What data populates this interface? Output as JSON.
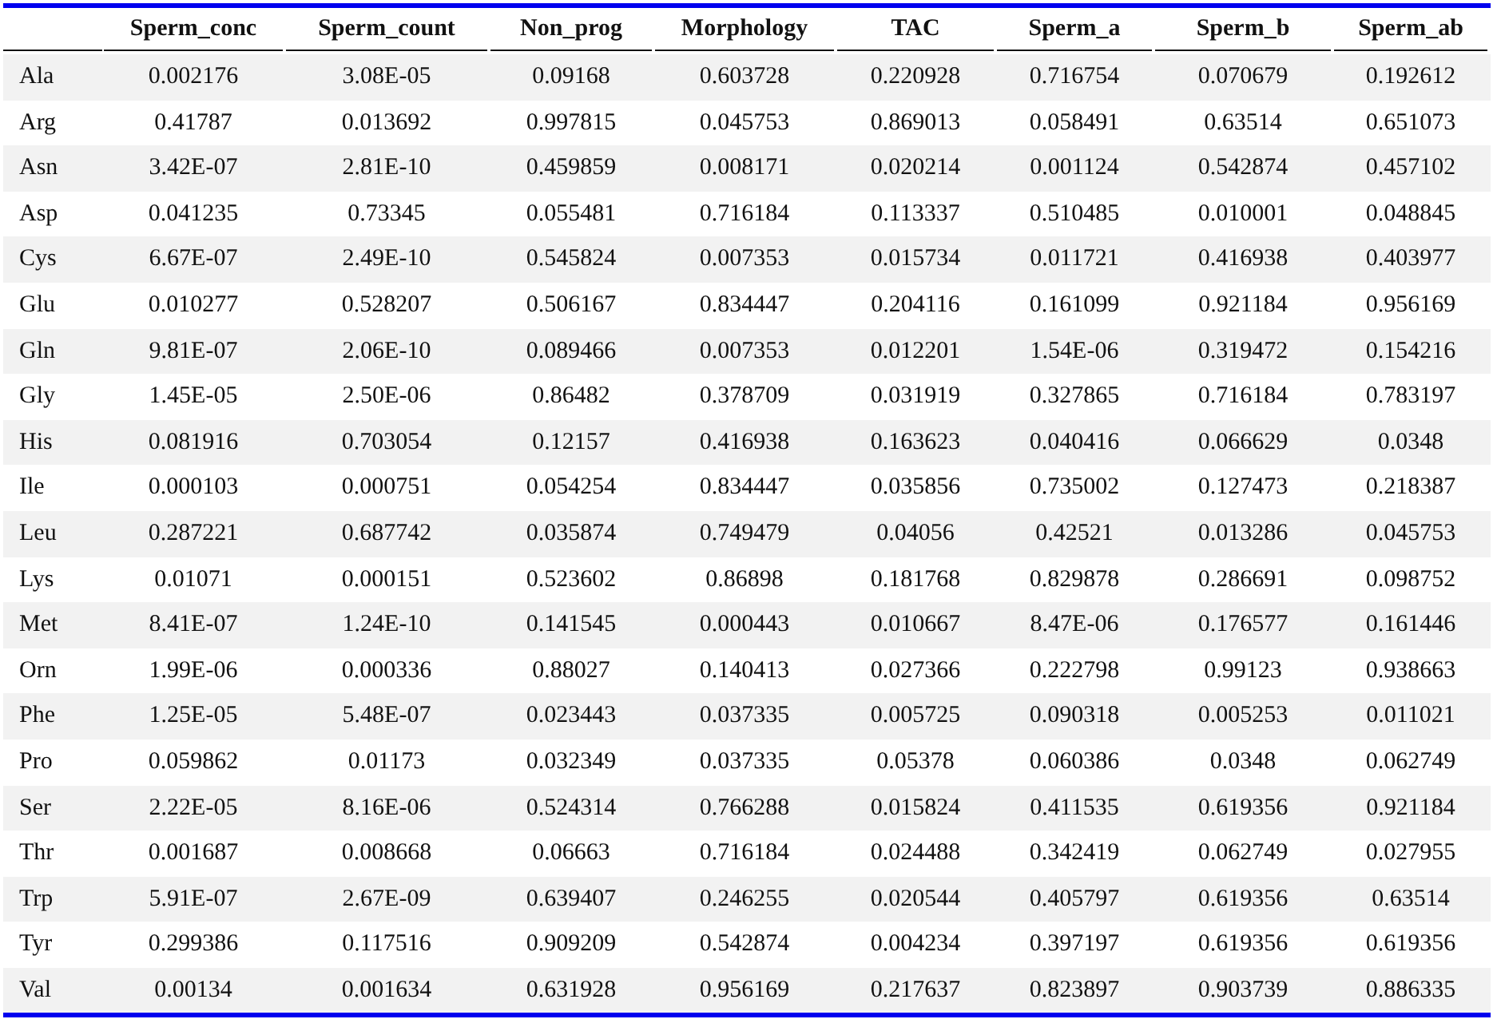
{
  "table": {
    "columns": [
      "Sperm_conc",
      "Sperm_count",
      "Non_prog",
      "Morphology",
      "TAC",
      "Sperm_a",
      "Sperm_b",
      "Sperm_ab"
    ],
    "rows": [
      {
        "label": "Ala",
        "values": [
          "0.002176",
          "3.08E-05",
          "0.09168",
          "0.603728",
          "0.220928",
          "0.716754",
          "0.070679",
          "0.192612"
        ]
      },
      {
        "label": "Arg",
        "values": [
          "0.41787",
          "0.013692",
          "0.997815",
          "0.045753",
          "0.869013",
          "0.058491",
          "0.63514",
          "0.651073"
        ]
      },
      {
        "label": "Asn",
        "values": [
          "3.42E-07",
          "2.81E-10",
          "0.459859",
          "0.008171",
          "0.020214",
          "0.001124",
          "0.542874",
          "0.457102"
        ]
      },
      {
        "label": "Asp",
        "values": [
          "0.041235",
          "0.73345",
          "0.055481",
          "0.716184",
          "0.113337",
          "0.510485",
          "0.010001",
          "0.048845"
        ]
      },
      {
        "label": "Cys",
        "values": [
          "6.67E-07",
          "2.49E-10",
          "0.545824",
          "0.007353",
          "0.015734",
          "0.011721",
          "0.416938",
          "0.403977"
        ]
      },
      {
        "label": "Glu",
        "values": [
          "0.010277",
          "0.528207",
          "0.506167",
          "0.834447",
          "0.204116",
          "0.161099",
          "0.921184",
          "0.956169"
        ]
      },
      {
        "label": "Gln",
        "values": [
          "9.81E-07",
          "2.06E-10",
          "0.089466",
          "0.007353",
          "0.012201",
          "1.54E-06",
          "0.319472",
          "0.154216"
        ]
      },
      {
        "label": "Gly",
        "values": [
          "1.45E-05",
          "2.50E-06",
          "0.86482",
          "0.378709",
          "0.031919",
          "0.327865",
          "0.716184",
          "0.783197"
        ]
      },
      {
        "label": "His",
        "values": [
          "0.081916",
          "0.703054",
          "0.12157",
          "0.416938",
          "0.163623",
          "0.040416",
          "0.066629",
          "0.0348"
        ]
      },
      {
        "label": "Ile",
        "values": [
          "0.000103",
          "0.000751",
          "0.054254",
          "0.834447",
          "0.035856",
          "0.735002",
          "0.127473",
          "0.218387"
        ]
      },
      {
        "label": "Leu",
        "values": [
          "0.287221",
          "0.687742",
          "0.035874",
          "0.749479",
          "0.04056",
          "0.42521",
          "0.013286",
          "0.045753"
        ]
      },
      {
        "label": "Lys",
        "values": [
          "0.01071",
          "0.000151",
          "0.523602",
          "0.86898",
          "0.181768",
          "0.829878",
          "0.286691",
          "0.098752"
        ]
      },
      {
        "label": "Met",
        "values": [
          "8.41E-07",
          "1.24E-10",
          "0.141545",
          "0.000443",
          "0.010667",
          "8.47E-06",
          "0.176577",
          "0.161446"
        ]
      },
      {
        "label": "Orn",
        "values": [
          "1.99E-06",
          "0.000336",
          "0.88027",
          "0.140413",
          "0.027366",
          "0.222798",
          "0.99123",
          "0.938663"
        ]
      },
      {
        "label": "Phe",
        "values": [
          "1.25E-05",
          "5.48E-07",
          "0.023443",
          "0.037335",
          "0.005725",
          "0.090318",
          "0.005253",
          "0.011021"
        ]
      },
      {
        "label": "Pro",
        "values": [
          "0.059862",
          "0.01173",
          "0.032349",
          "0.037335",
          "0.05378",
          "0.060386",
          "0.0348",
          "0.062749"
        ]
      },
      {
        "label": "Ser",
        "values": [
          "2.22E-05",
          "8.16E-06",
          "0.524314",
          "0.766288",
          "0.015824",
          "0.411535",
          "0.619356",
          "0.921184"
        ]
      },
      {
        "label": "Thr",
        "values": [
          "0.001687",
          "0.008668",
          "0.06663",
          "0.716184",
          "0.024488",
          "0.342419",
          "0.062749",
          "0.027955"
        ]
      },
      {
        "label": "Trp",
        "values": [
          "5.91E-07",
          "2.67E-09",
          "0.639407",
          "0.246255",
          "0.020544",
          "0.405797",
          "0.619356",
          "0.63514"
        ]
      },
      {
        "label": "Tyr",
        "values": [
          "0.299386",
          "0.117516",
          "0.909209",
          "0.542874",
          "0.004234",
          "0.397197",
          "0.619356",
          "0.619356"
        ]
      },
      {
        "label": "Val",
        "values": [
          "0.00134",
          "0.001634",
          "0.631928",
          "0.956169",
          "0.217637",
          "0.823897",
          "0.903739",
          "0.886335"
        ]
      }
    ]
  }
}
